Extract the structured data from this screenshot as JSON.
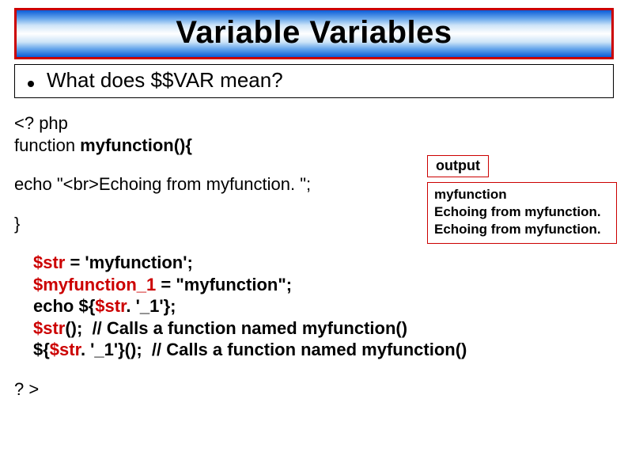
{
  "title": "Variable Variables",
  "bullet": "What does $$VAR mean?",
  "code": {
    "l1": "<? php",
    "l2a": "function ",
    "l2b": "myfunction(){",
    "l3": "echo \"<br>Echoing from myfunction. \";",
    "l4": "}",
    "s1a": "$str",
    "s1b": " = 'myfunction';",
    "s2a": "$myfunction_1",
    "s2b": " = \"myfunction\";",
    "s3a": "echo ${",
    "s3b": "$str",
    "s3c": ". '_1'};",
    "s4a": "$str",
    "s4b": "();  // Calls a function named myfunction()",
    "s5a": "${",
    "s5b": "$str",
    "s5c": ". '_1'}();  // Calls a function named myfunction()",
    "end": "? >"
  },
  "output": {
    "label": "output",
    "l1": "myfunction",
    "l2": "Echoing from myfunction.",
    "l3": "Echoing from myfunction."
  }
}
